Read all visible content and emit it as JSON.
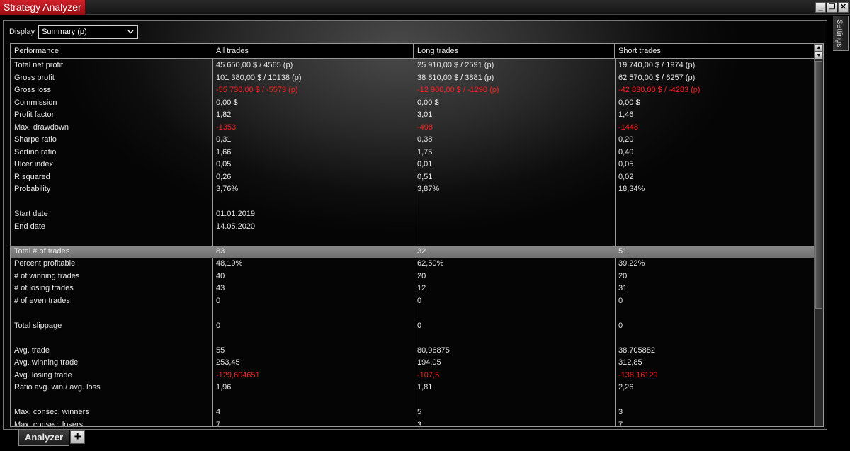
{
  "window": {
    "title": "Strategy Analyzer",
    "minimize": "_",
    "restore": "❐",
    "close": "✕",
    "settings_tab": "Settings"
  },
  "display": {
    "label": "Display",
    "value": "Summary (p)"
  },
  "columns": [
    "Performance",
    "All trades",
    "Long trades",
    "Short trades"
  ],
  "rows": [
    {
      "label": "Total net profit",
      "all": "45 650,00 $ / 4565 (p)",
      "long": "25 910,00 $ / 2591 (p)",
      "short": "19 740,00 $ / 1974 (p)"
    },
    {
      "label": "Gross profit",
      "all": "101 380,00 $ / 10138 (p)",
      "long": "38 810,00 $ / 3881 (p)",
      "short": "62 570,00 $ / 6257 (p)"
    },
    {
      "label": "Gross loss",
      "all": "-55 730,00 $ / -5573 (p)",
      "long": "-12 900,00 $ / -1290 (p)",
      "short": "-42 830,00 $ / -4283 (p)",
      "neg": true
    },
    {
      "label": "Commission",
      "all": "0,00 $",
      "long": "0,00 $",
      "short": "0,00 $"
    },
    {
      "label": "Profit factor",
      "all": "1,82",
      "long": "3,01",
      "short": "1,46"
    },
    {
      "label": "Max. drawdown",
      "all": "-1353",
      "long": "-498",
      "short": "-1448",
      "neg": true
    },
    {
      "label": "Sharpe ratio",
      "all": "0,31",
      "long": "0,38",
      "short": "0,20"
    },
    {
      "label": "Sortino ratio",
      "all": "1,66",
      "long": "1,75",
      "short": "0,40"
    },
    {
      "label": "Ulcer index",
      "all": "0,05",
      "long": "0,01",
      "short": "0,05"
    },
    {
      "label": "R squared",
      "all": "0,26",
      "long": "0,51",
      "short": "0,02"
    },
    {
      "label": "Probability",
      "all": "3,76%",
      "long": "3,87%",
      "short": "18,34%"
    },
    {
      "label": "",
      "all": "",
      "long": "",
      "short": ""
    },
    {
      "label": "Start date",
      "all": "01.01.2019",
      "long": "",
      "short": ""
    },
    {
      "label": "End date",
      "all": "14.05.2020",
      "long": "",
      "short": ""
    },
    {
      "label": "",
      "all": "",
      "long": "",
      "short": ""
    },
    {
      "label": "Total # of trades",
      "all": "83",
      "long": "32",
      "short": "51",
      "highlight": true
    },
    {
      "label": "Percent profitable",
      "all": "48,19%",
      "long": "62,50%",
      "short": "39,22%"
    },
    {
      "label": "# of winning trades",
      "all": "40",
      "long": "20",
      "short": "20"
    },
    {
      "label": "# of losing trades",
      "all": "43",
      "long": "12",
      "short": "31"
    },
    {
      "label": "# of even trades",
      "all": "0",
      "long": "0",
      "short": "0"
    },
    {
      "label": "",
      "all": "",
      "long": "",
      "short": ""
    },
    {
      "label": "Total slippage",
      "all": "0",
      "long": "0",
      "short": "0"
    },
    {
      "label": "",
      "all": "",
      "long": "",
      "short": ""
    },
    {
      "label": "Avg. trade",
      "all": "55",
      "long": "80,96875",
      "short": "38,705882"
    },
    {
      "label": "Avg. winning trade",
      "all": "253,45",
      "long": "194,05",
      "short": "312,85"
    },
    {
      "label": "Avg. losing trade",
      "all": "-129,604651",
      "long": "-107,5",
      "short": "-138,16129",
      "neg": true
    },
    {
      "label": "Ratio avg. win / avg. loss",
      "all": "1,96",
      "long": "1,81",
      "short": "2,26"
    },
    {
      "label": "",
      "all": "",
      "long": "",
      "short": ""
    },
    {
      "label": "Max. consec. winners",
      "all": "4",
      "long": "5",
      "short": "3"
    },
    {
      "label": "Max. consec. losers",
      "all": "7",
      "long": "3",
      "short": "7"
    }
  ],
  "scrollbar": {
    "up": "▲",
    "down": "▼"
  },
  "bottom_tabs": {
    "active": "Analyzer",
    "add": "+"
  },
  "colors": {
    "negative": "#ff1e1e",
    "title_tab": "#c0141e",
    "highlight_row": "#808080"
  }
}
